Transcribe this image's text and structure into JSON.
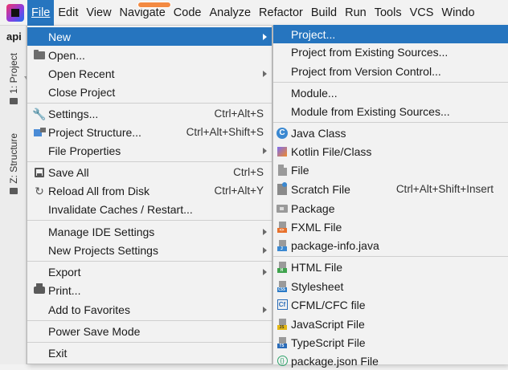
{
  "menubar": {
    "items": [
      {
        "label": "File",
        "active": true
      },
      {
        "label": "Edit"
      },
      {
        "label": "View"
      },
      {
        "label": "Navigate"
      },
      {
        "label": "Code"
      },
      {
        "label": "Analyze"
      },
      {
        "label": "Refactor"
      },
      {
        "label": "Build"
      },
      {
        "label": "Run"
      },
      {
        "label": "Tools"
      },
      {
        "label": "VCS"
      },
      {
        "label": "Windo"
      }
    ]
  },
  "project": {
    "label": "api"
  },
  "sidebar": {
    "project_tab": "1: Project",
    "structure_tab": "Z: Structure"
  },
  "file_menu": {
    "items": [
      {
        "label": "New",
        "shortcut": "",
        "submenu": true,
        "icon": "none",
        "selected": true
      },
      {
        "label": "Open...",
        "shortcut": "",
        "icon": "folder-icon"
      },
      {
        "label": "Open Recent",
        "shortcut": "",
        "submenu": true
      },
      {
        "label": "Close Project",
        "shortcut": ""
      },
      {
        "label": "Settings...",
        "shortcut": "Ctrl+Alt+S",
        "icon": "wrench-icon"
      },
      {
        "label": "Project Structure...",
        "shortcut": "Ctrl+Alt+Shift+S",
        "icon": "project-structure-icon"
      },
      {
        "label": "File Properties",
        "shortcut": "",
        "submenu": true
      },
      {
        "label": "Save All",
        "shortcut": "Ctrl+S",
        "icon": "save-icon"
      },
      {
        "label": "Reload All from Disk",
        "shortcut": "Ctrl+Alt+Y",
        "icon": "reload-icon"
      },
      {
        "label": "Invalidate Caches / Restart...",
        "shortcut": ""
      },
      {
        "label": "Manage IDE Settings",
        "shortcut": "",
        "submenu": true
      },
      {
        "label": "New Projects Settings",
        "shortcut": "",
        "submenu": true
      },
      {
        "label": "Export",
        "shortcut": "",
        "submenu": true
      },
      {
        "label": "Print...",
        "shortcut": "",
        "icon": "print-icon"
      },
      {
        "label": "Add to Favorites",
        "shortcut": "",
        "submenu": true
      },
      {
        "label": "Power Save Mode",
        "shortcut": ""
      },
      {
        "label": "Exit",
        "shortcut": ""
      }
    ]
  },
  "new_menu": {
    "items": [
      {
        "label": "Project...",
        "selected": true
      },
      {
        "label": "Project from Existing Sources..."
      },
      {
        "label": "Project from Version Control..."
      },
      {
        "label": "Module..."
      },
      {
        "label": "Module from Existing Sources..."
      },
      {
        "label": "Java Class",
        "icon": "java-class-icon"
      },
      {
        "label": "Kotlin File/Class",
        "icon": "kotlin-icon"
      },
      {
        "label": "File",
        "icon": "file-icon"
      },
      {
        "label": "Scratch File",
        "shortcut": "Ctrl+Alt+Shift+Insert",
        "icon": "scratch-file-icon"
      },
      {
        "label": "Package",
        "icon": "package-icon"
      },
      {
        "label": "FXML File",
        "icon": "fxml-icon"
      },
      {
        "label": "package-info.java",
        "icon": "package-info-icon"
      },
      {
        "label": "HTML File",
        "icon": "html-icon"
      },
      {
        "label": "Stylesheet",
        "icon": "css-icon"
      },
      {
        "label": "CFML/CFC file",
        "icon": "cfml-icon"
      },
      {
        "label": "JavaScript File",
        "icon": "javascript-icon"
      },
      {
        "label": "TypeScript File",
        "icon": "typescript-icon"
      },
      {
        "label": "package.json File",
        "icon": "package-json-icon"
      }
    ]
  },
  "colors": {
    "selection": "#2675bf",
    "menu_bg": "#f2f2f2",
    "java": "#3a88d1",
    "fxml": "#e8702a",
    "html": "#3fa34d",
    "css": "#2a7ac7",
    "javascript": "#e3b714",
    "typescript": "#2a6cb8",
    "package_json": "#2ea36b"
  }
}
